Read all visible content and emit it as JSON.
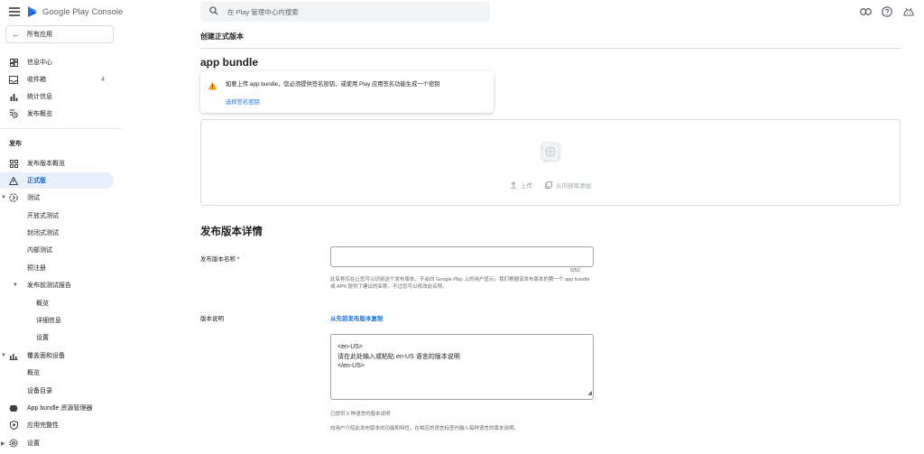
{
  "brand": {
    "name": "Google Play",
    "product": "Console"
  },
  "search": {
    "placeholder": "在 Play 管理中心内搜索"
  },
  "sidebar": {
    "all_apps": "所有应用",
    "top_items": [
      {
        "label": "信息中心",
        "icon": "dashboard-icon"
      },
      {
        "label": "收件箱",
        "icon": "inbox-icon",
        "count": "4"
      },
      {
        "label": "统计信息",
        "icon": "statistics-icon"
      },
      {
        "label": "发布概览",
        "icon": "publishing-overview-icon"
      }
    ],
    "section_release": "发布",
    "release_items": [
      {
        "label": "发布版本概览",
        "icon": "releases-overview-icon"
      },
      {
        "label": "正式版",
        "icon": "production-icon",
        "active": true
      },
      {
        "label": "测试",
        "icon": "testing-icon",
        "expanded": true
      },
      {
        "label": "开放式测试"
      },
      {
        "label": "封闭式测试"
      },
      {
        "label": "内部测试"
      },
      {
        "label": "预注册"
      },
      {
        "label": "发布前测试报告",
        "expanded": true
      },
      {
        "label": "概览"
      },
      {
        "label": "详细信息"
      },
      {
        "label": "设置"
      },
      {
        "label": "覆盖面和设备",
        "icon": "reach-devices-icon",
        "expanded": true
      },
      {
        "label": "概览"
      },
      {
        "label": "设备目录"
      },
      {
        "label": "App bundle 资源管理器",
        "icon": "bundle-explorer-icon"
      },
      {
        "label": "应用完整性",
        "icon": "app-integrity-icon"
      },
      {
        "label": "设置",
        "icon": "settings-icon"
      }
    ]
  },
  "main": {
    "page_title": "创建正式版本",
    "bundle_heading": "app bundle",
    "warning": {
      "text": "如要上传 app bundle，您必须提供签名密钥，或使用 Play 应用签名功能生成一个密钥",
      "link": "选择签名密钥"
    },
    "upload": {
      "upload_label": "上传",
      "library_label": "从内容库添加"
    },
    "details_heading": "发布版本详情",
    "release_name": {
      "label": "发布版本名称 *",
      "value": "",
      "counter": "0/50",
      "help": "此名称仅在让您可以识别这个发布版本，不会向 Google Play 上的用户显示。我们根据该发布版本的第一个 app bundle 或 APK 提供了建议的名称，不过您可以修改此名称。"
    },
    "release_notes": {
      "label": "版本说明",
      "copy_link": "从先前发布版本复制",
      "value": "<en-US>\n请在此处输入或粘贴 en-US 语言的版本说明\n</en-US>",
      "languages_info": "已提供 0 种语言的版本说明",
      "help": "向用户介绍此发布版本的功能和特性。在相应的语言标签内输入每种语言的版本说明。"
    }
  },
  "colors": {
    "accent": "#1a73e8",
    "active_bg": "#e8f0fe",
    "warning": "#f9ab00"
  }
}
